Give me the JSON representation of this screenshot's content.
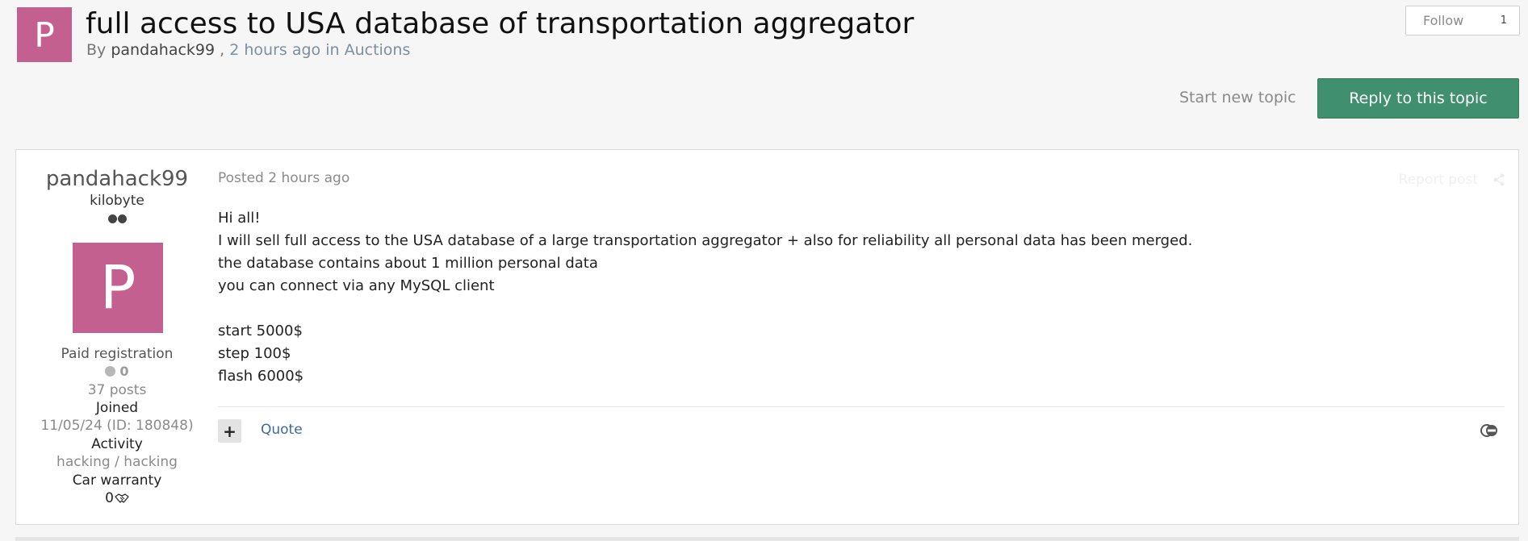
{
  "topic": {
    "avatar_letter": "P",
    "title": "full access to USA database of transportation aggregator",
    "by_prefix": "By",
    "author": "pandahack99",
    "comma": ",",
    "time": "2 hours ago",
    "in_word": "in",
    "forum": "Auctions"
  },
  "follow": {
    "label": "Follow",
    "count": "1"
  },
  "actions": {
    "start_new_topic": "Start new topic",
    "reply": "Reply to this topic"
  },
  "author": {
    "name": "pandahack99",
    "rank": "kilobyte",
    "avatar_letter": "P",
    "group": "Paid registration",
    "reputation": "0",
    "posts": "37 posts",
    "joined_label": "Joined",
    "joined_value": "11/05/24 (ID: 180848)",
    "activity_label": "Activity",
    "activity_value": "hacking / hacking",
    "warranty_label": "Car warranty",
    "warranty_value": "0"
  },
  "post": {
    "meta": "Posted 2 hours ago",
    "report": "Report post",
    "lines": [
      "Hi all!",
      "I will sell full access to the USA database of a large transportation aggregator + also for reliability all personal data has been merged.",
      "the database contains about 1 million personal data",
      "you can connect via any MySQL client",
      "",
      "start 5000$",
      "step 100$",
      "flash 6000$"
    ],
    "quote": "Quote",
    "plus": "+"
  },
  "colors": {
    "avatar": "#c4608f",
    "reply_button": "#408f6e",
    "link": "#3d6a9a"
  },
  "icons": [
    "share-icon",
    "ignore-icon",
    "handshake-icon"
  ]
}
